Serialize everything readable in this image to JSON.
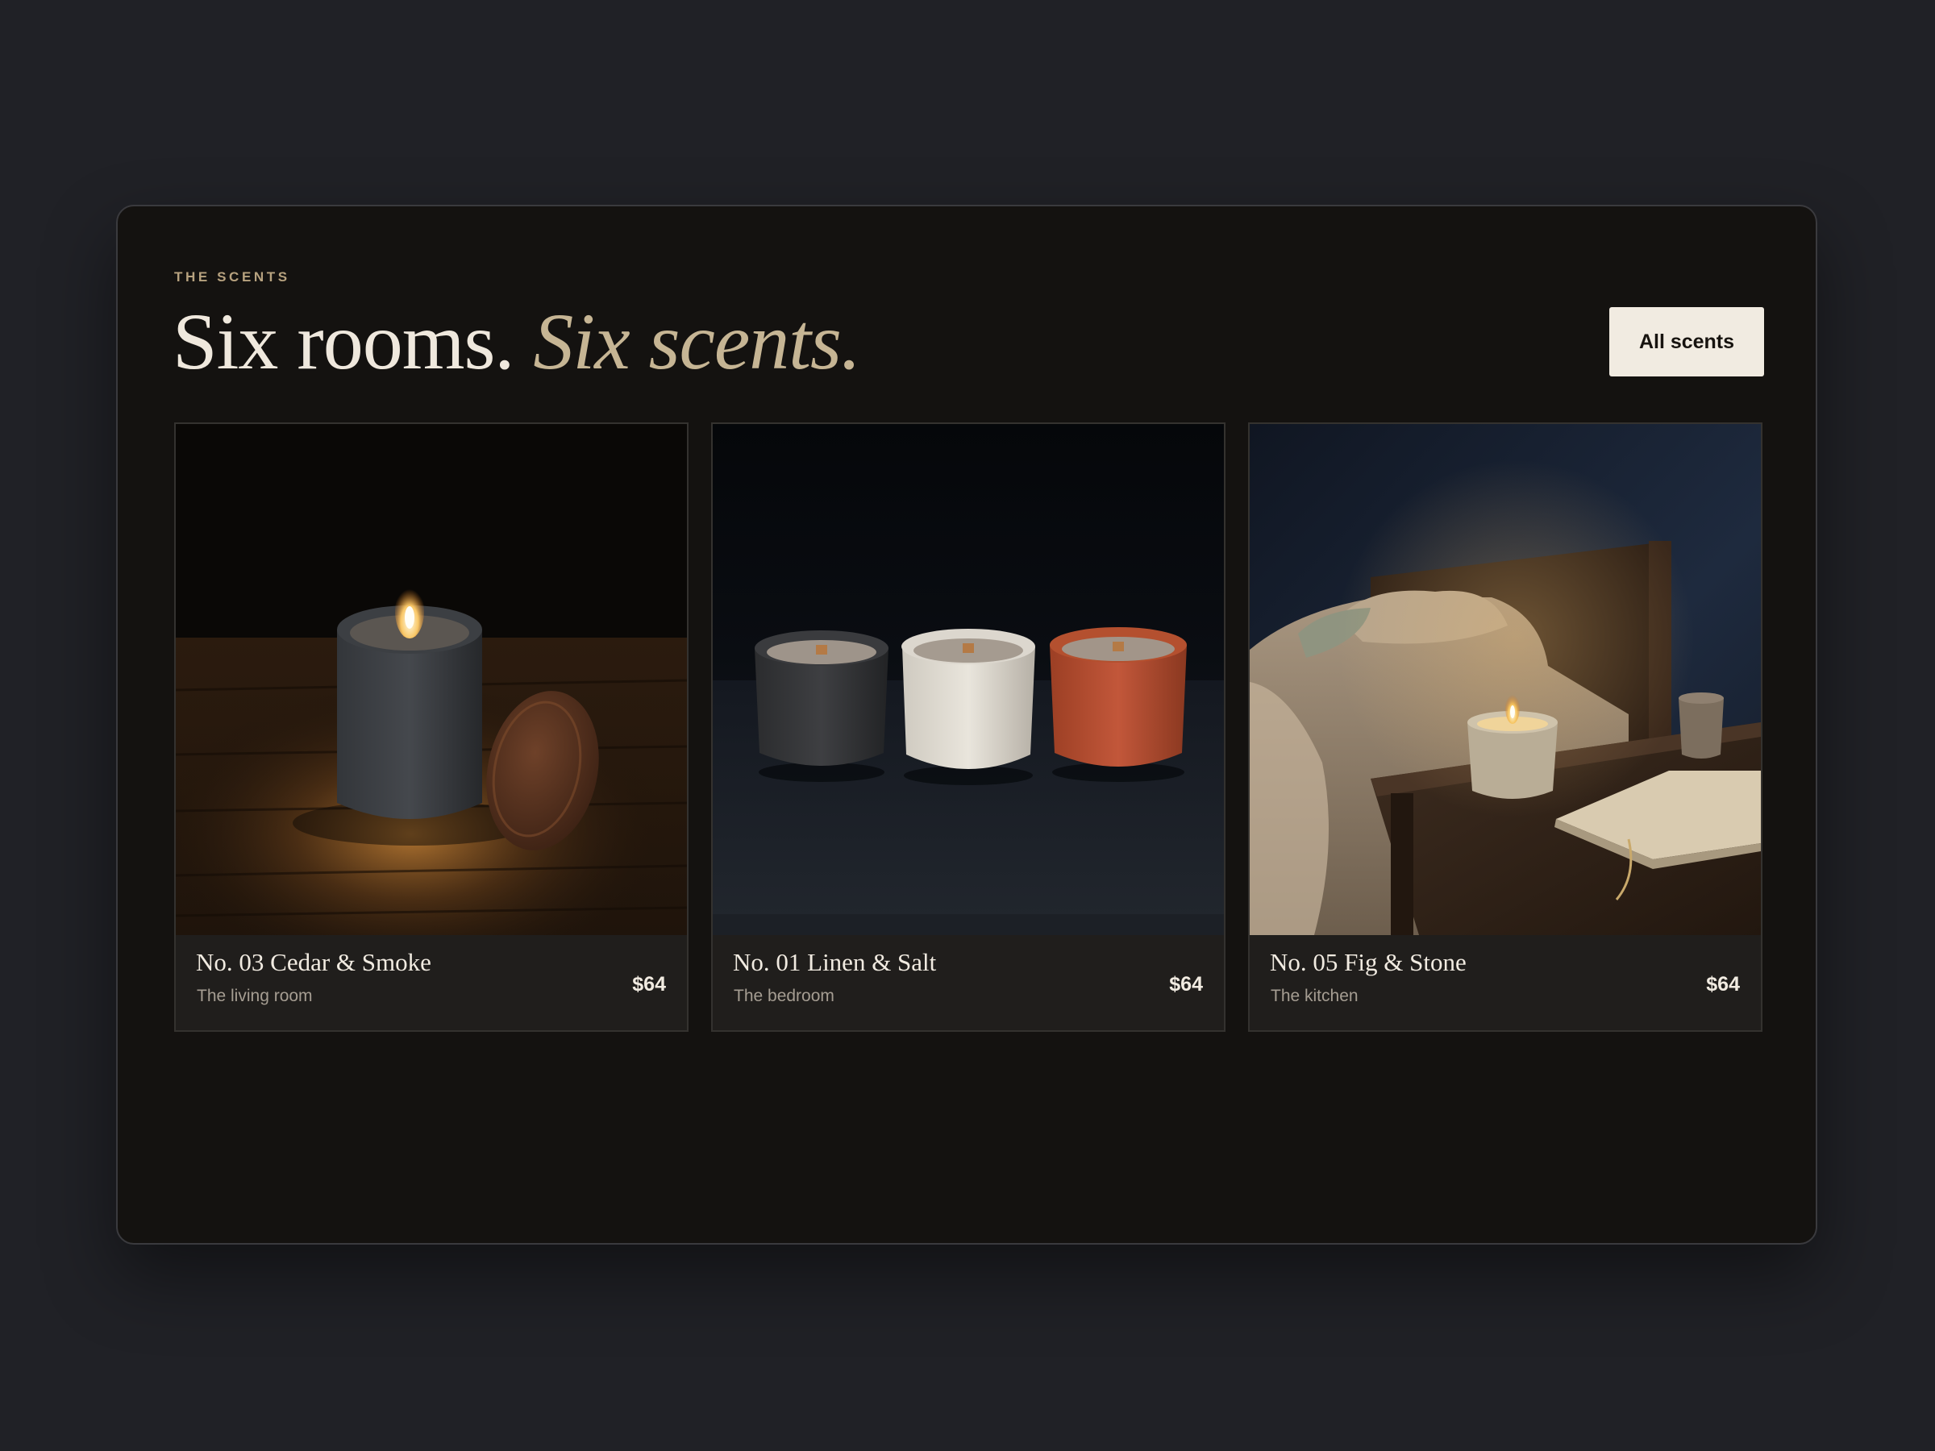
{
  "section": {
    "eyebrow": "THE SCENTS",
    "headline_plain": "Six rooms. ",
    "headline_accent": "Six scents.",
    "all_button_label": "All scents"
  },
  "products": [
    {
      "name": "No. 03 Cedar & Smoke",
      "room": "The living room",
      "price": "$64"
    },
    {
      "name": "No. 01 Linen & Salt",
      "room": "The bedroom",
      "price": "$64"
    },
    {
      "name": "No. 05 Fig & Stone",
      "room": "The kitchen",
      "price": "$64"
    }
  ],
  "colors": {
    "page_background": "#202126",
    "panel_background": "#141210",
    "card_background": "#201e1c",
    "accent_gold": "#c6b594",
    "button_background": "#f1ebe1"
  }
}
